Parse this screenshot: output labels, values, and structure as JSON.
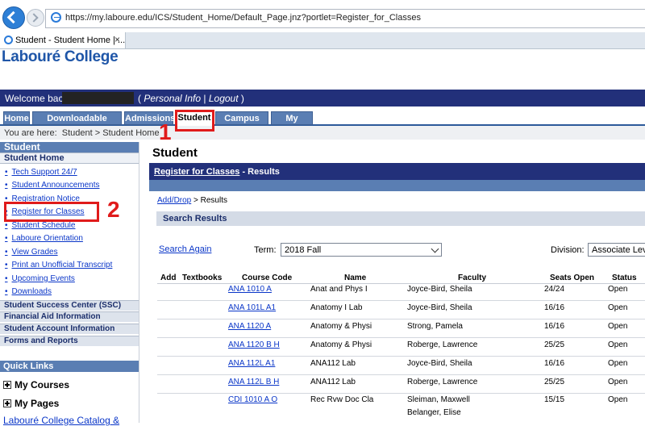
{
  "browser": {
    "url": "https://my.laboure.edu/ICS/Student_Home/Default_Page.jnz?portlet=Register_for_Classes",
    "tab_title": "Student - Student Home | ...",
    "tab_close": "×"
  },
  "header": {
    "logo": "Labouré College",
    "welcome": "Welcome back",
    "personal_info": "Personal Info",
    "logout": "Logout",
    "bar_color": "#22307a"
  },
  "tabs": [
    {
      "label": "Home"
    },
    {
      "label": "Downloadable Forms"
    },
    {
      "label": "Admissions"
    },
    {
      "label": "Student"
    },
    {
      "label": "Campus Life"
    },
    {
      "label": "My Pages"
    }
  ],
  "breadcrumb": {
    "prefix": "You are here:",
    "path": "Student > Student Home"
  },
  "annotations": {
    "one": "1",
    "two": "2",
    "color": "#e01b1b"
  },
  "sidebar": {
    "title": "Student",
    "home": "Student Home",
    "links": [
      "Tech Support 24/7",
      "Student Announcements",
      "Registration Notice",
      "Register for Classes",
      "Student Schedule",
      "Laboure Orientation",
      "View Grades",
      "Print an Unofficial Transcript",
      "Upcoming Events",
      "Downloads"
    ],
    "sections": [
      "Student Success Center (SSC)",
      "Financial Aid Information",
      "Student Account Information",
      "Forms and Reports"
    ],
    "quick_links": {
      "title": "Quick Links",
      "items": [
        "My Courses",
        "My Pages"
      ],
      "catalog": "Labouré College Catalog &"
    }
  },
  "main": {
    "title": "Student",
    "portlet_link": "Register for Classes",
    "portlet_suffix": " - Results",
    "crumb_link": "Add/Drop",
    "crumb_rest": " > Results",
    "results_heading": "Search Results",
    "search_again": "Search Again",
    "term_label": "Term:",
    "term_value": "2018 Fall",
    "division_label": "Division:",
    "division_value": "Associate Lev"
  },
  "table": {
    "headers": [
      "Add",
      "Textbooks",
      "Course Code",
      "Name",
      "Faculty",
      "Seats Open",
      "Status"
    ],
    "rows": [
      {
        "code": "ANA 1010 A",
        "name": "Anat and Phys I",
        "faculty": "Joyce-Bird, Sheila",
        "seats": "24/24",
        "status": "Open"
      },
      {
        "code": "ANA 101L A1",
        "name": "Anatomy I Lab",
        "faculty": "Joyce-Bird, Sheila",
        "seats": "16/16",
        "status": "Open"
      },
      {
        "code": "ANA 1120 A",
        "name": "Anatomy & Physi",
        "faculty": "Strong, Pamela",
        "seats": "16/16",
        "status": "Open"
      },
      {
        "code": "ANA 1120 B H",
        "name": "Anatomy & Physi",
        "faculty": "Roberge, Lawrence",
        "seats": "25/25",
        "status": "Open"
      },
      {
        "code": "ANA 112L A1",
        "name": "ANA112 Lab",
        "faculty": "Joyce-Bird, Sheila",
        "seats": "16/16",
        "status": "Open"
      },
      {
        "code": "ANA 112L B H",
        "name": "ANA112 Lab",
        "faculty": "Roberge, Lawrence",
        "seats": "25/25",
        "status": "Open"
      },
      {
        "code": "CDI 1010 A O",
        "name": "Rec Rvw Doc Cla",
        "faculty": "Sleiman, Maxwell",
        "faculty2": "Belanger, Elise",
        "seats": "15/15",
        "status": "Open"
      }
    ]
  }
}
